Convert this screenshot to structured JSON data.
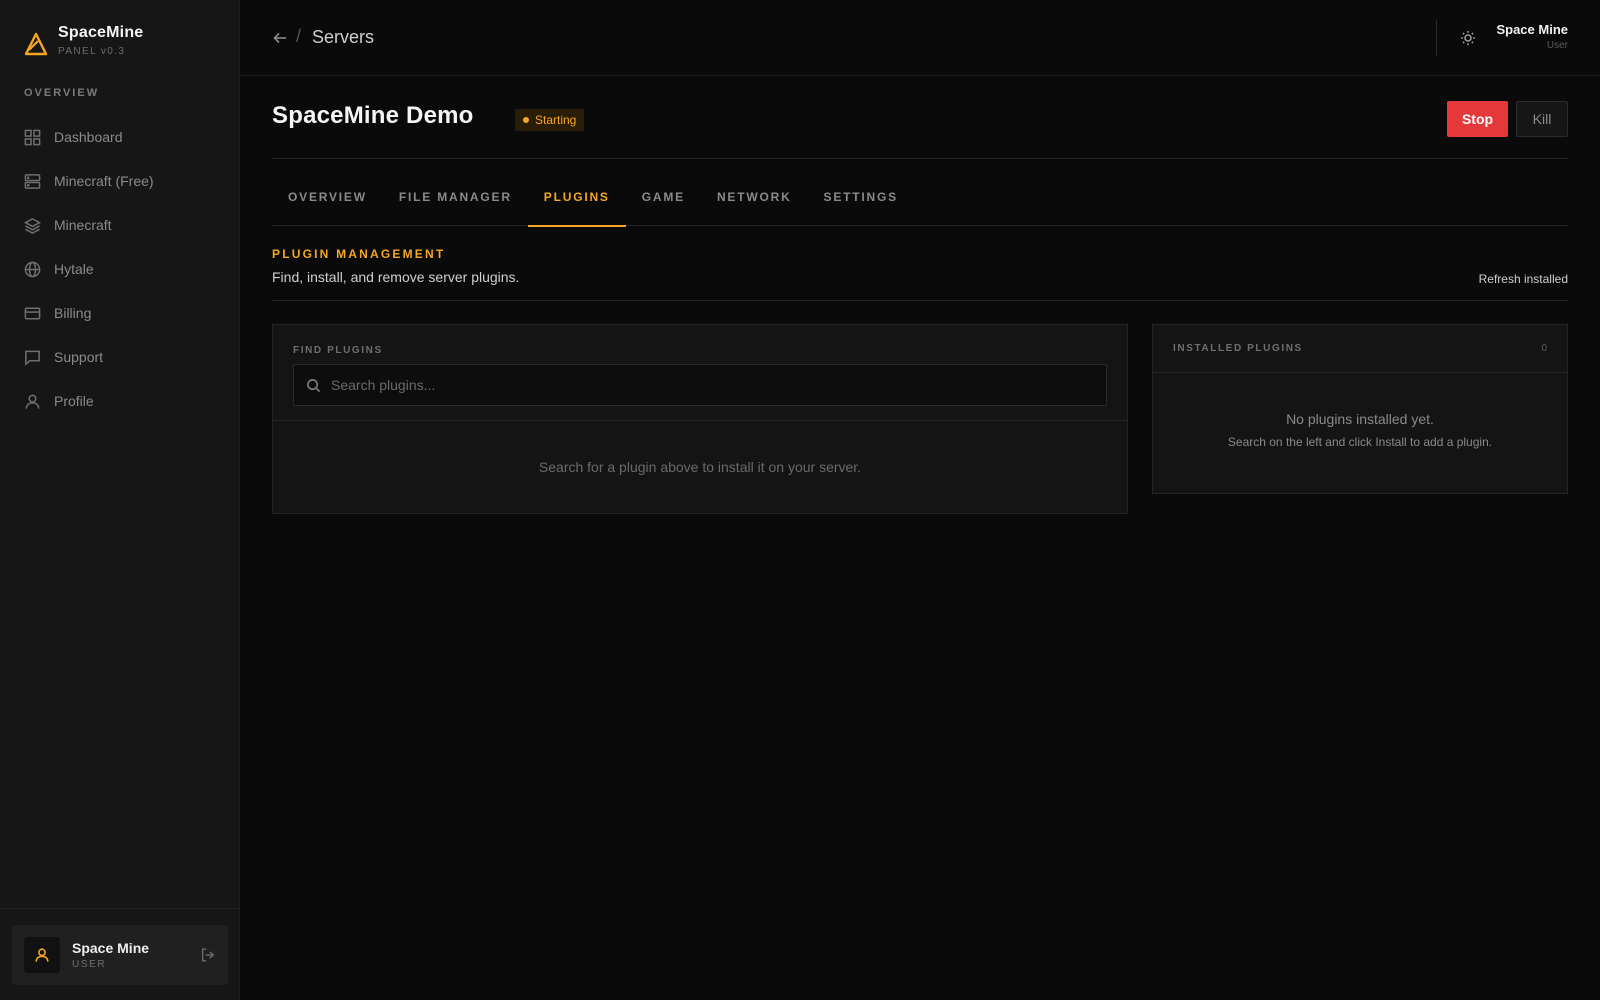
{
  "brand": {
    "name": "SpaceMine",
    "version": "PANEL v0.3"
  },
  "sidebar": {
    "section": "OVERVIEW",
    "items": [
      {
        "label": "Dashboard",
        "icon": "grid-icon"
      },
      {
        "label": "Minecraft (Free)",
        "icon": "server-icon"
      },
      {
        "label": "Minecraft",
        "icon": "layers-icon"
      },
      {
        "label": "Hytale",
        "icon": "globe-icon"
      },
      {
        "label": "Billing",
        "icon": "credit-card-icon"
      },
      {
        "label": "Support",
        "icon": "message-icon"
      },
      {
        "label": "Profile",
        "icon": "user-icon"
      }
    ],
    "user": {
      "name": "Space Mine",
      "role": "USER"
    }
  },
  "header": {
    "breadcrumb": "Servers",
    "separator": "/",
    "user": {
      "name": "Space Mine",
      "role": "User"
    }
  },
  "server": {
    "name": "SpaceMine Demo",
    "status": "Starting",
    "stop_label": "Stop",
    "kill_label": "Kill"
  },
  "tabs": [
    {
      "label": "OVERVIEW",
      "active": false
    },
    {
      "label": "FILE MANAGER",
      "active": false
    },
    {
      "label": "PLUGINS",
      "active": true
    },
    {
      "label": "GAME",
      "active": false
    },
    {
      "label": "NETWORK",
      "active": false
    },
    {
      "label": "SETTINGS",
      "active": false
    }
  ],
  "plugins": {
    "title": "PLUGIN MANAGEMENT",
    "description": "Find, install, and remove server plugins.",
    "refresh_label": "Refresh installed",
    "find": {
      "label": "FIND PLUGINS",
      "placeholder": "Search plugins...",
      "empty": "Search for a plugin above to install it on your server."
    },
    "installed": {
      "label": "INSTALLED PLUGINS",
      "count": "0",
      "empty_title": "No plugins installed yet.",
      "empty_sub": "Search on the left and click Install to add a plugin."
    }
  },
  "colors": {
    "accent": "#f5a623",
    "danger": "#e5383b",
    "background": "#0a0a0a",
    "sidebar": "#161616"
  }
}
